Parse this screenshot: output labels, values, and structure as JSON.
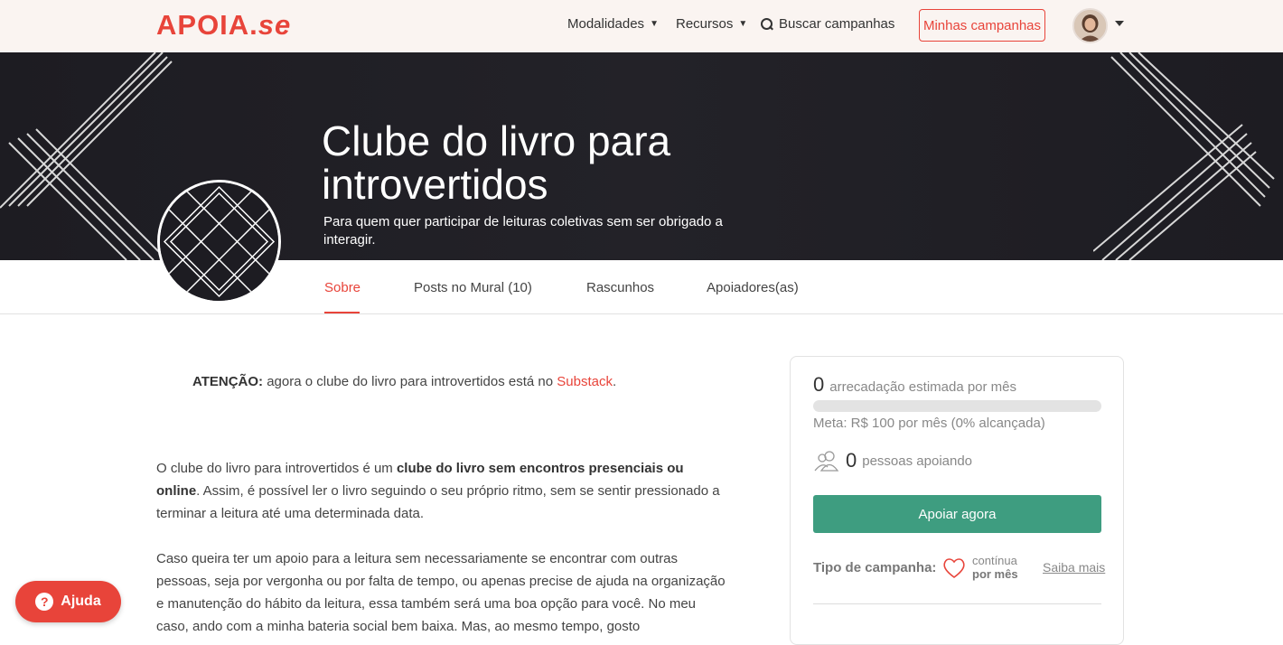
{
  "header": {
    "logo_main": "APOIA.",
    "logo_suffix": "se",
    "nav": [
      {
        "label": "Modalidades"
      },
      {
        "label": "Recursos"
      }
    ],
    "search_label": "Buscar campanhas",
    "my_campaigns_label": "Minhas campanhas",
    "avatar_icon": "user-avatar"
  },
  "hero": {
    "title": "Clube do livro para introvertidos",
    "subtitle": "Para quem quer participar de leituras coletivas sem ser obrigado a interagir."
  },
  "tabs": [
    {
      "label": "Sobre",
      "active": true
    },
    {
      "label": "Posts no Mural (10)",
      "active": false
    },
    {
      "label": "Rascunhos",
      "active": false
    },
    {
      "label": "Apoiadores(as)",
      "active": false
    }
  ],
  "content": {
    "attention_label": "ATENÇÃO:",
    "attention_text": " agora o clube do livro para introvertidos está no ",
    "attention_link": "Substack",
    "attention_end": ".",
    "p1_start": "O clube do livro para introvertidos é um ",
    "p1_bold": "clube do livro sem encontros presenciais ou online",
    "p1_end": ". Assim, é possível ler o livro seguindo o seu próprio ritmo, sem se sentir pressionado a terminar a leitura até uma determinada data.",
    "p2": "Caso queira ter um apoio para a leitura sem necessariamente se encontrar com outras pessoas, seja por vergonha ou por falta de tempo, ou apenas precise de ajuda na organização e manutenção do hábito da leitura, essa também será uma boa opção para você. No meu caso, ando com a minha bateria social bem baixa. Mas, ao mesmo tempo, gosto"
  },
  "card": {
    "raised_value": "0",
    "raised_label": "arrecadação estimada por mês",
    "progress_fraction": 0,
    "meta_text": "Meta: R$ 100 por mês (0% alcançada)",
    "supporters_count": "0",
    "supporters_label": "pessoas apoiando",
    "support_button": "Apoiar agora",
    "campaign_type_label": "Tipo de campanha:",
    "campaign_type_line1": "contínua",
    "campaign_type_line2": "por mês",
    "learn_more": "Saiba mais"
  },
  "help": {
    "label": "Ajuda",
    "glyph": "?"
  },
  "colors": {
    "brand": "#e8443a",
    "action": "#3e9d80",
    "hero_bg": "#1d1c22"
  }
}
